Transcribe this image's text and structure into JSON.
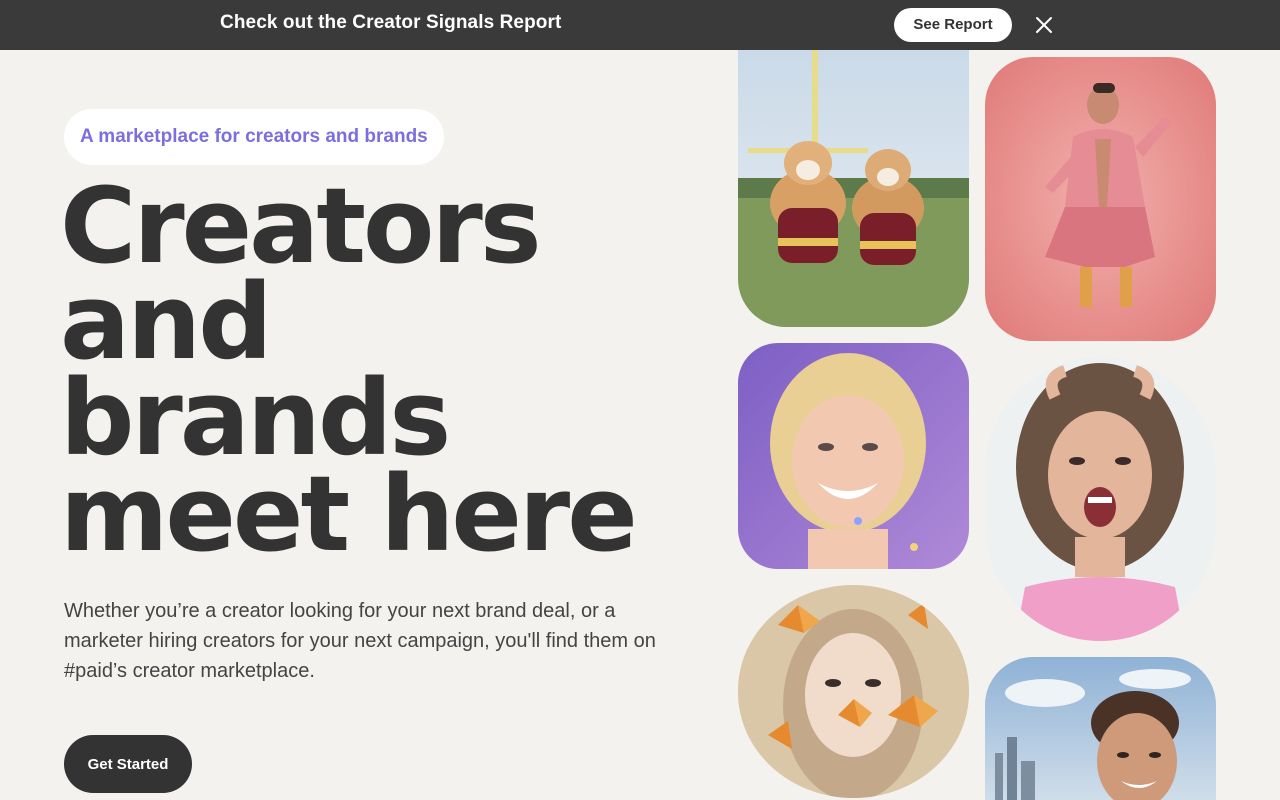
{
  "announcement": {
    "text": "Check out the Creator Signals Report",
    "button_label": "See Report",
    "close_icon": "close-icon"
  },
  "hero": {
    "tagline": "A marketplace for creators and brands",
    "headline_lines": [
      "Creators",
      "and",
      "brands",
      "meet here"
    ],
    "description": "Whether you’re a creator looking for your next brand deal, or a marketer hiring creators for your next campaign, you'll find them on #paid’s creator marketplace.",
    "cta_label": "Get Started"
  },
  "gallery": [
    {
      "name": "corgis-in-jerseys-photo"
    },
    {
      "name": "creator-in-pink-suit-photo"
    },
    {
      "name": "smiling-blonde-woman-photo"
    },
    {
      "name": "excited-woman-photo"
    },
    {
      "name": "butterfly-makeup-photo"
    },
    {
      "name": "curly-hair-man-city-photo"
    }
  ],
  "colors": {
    "announcement_bg": "#3a3a3a",
    "page_bg": "#f4f2ef",
    "accent_purple": "#7b6fe0",
    "text_dark": "#333333",
    "button_dark": "#333333"
  }
}
